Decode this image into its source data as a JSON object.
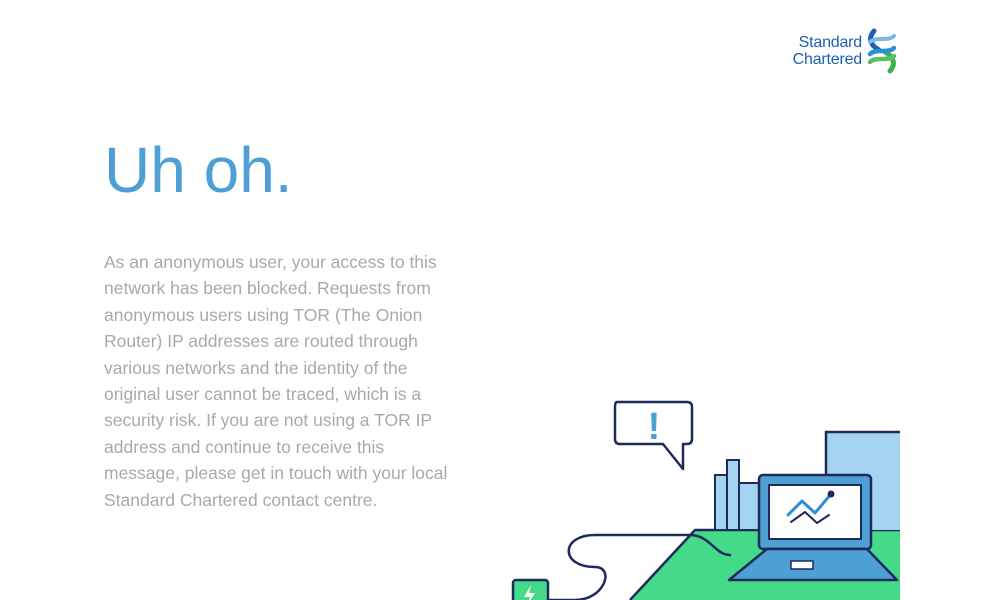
{
  "brand": {
    "line1": "Standard",
    "line2": "Chartered"
  },
  "headline": "Uh oh.",
  "message": "As an anonymous user, your access to this network has been blocked. Requests from anonymous users using TOR (The Onion Router) IP addresses are routed through various networks and the identity of the original user cannot be traced, which is a security risk. If you are not using a TOR IP address and continue to receive this message, please get in touch with your local Standard Chartered contact centre.",
  "illustration": {
    "alert_symbol": "!",
    "icons": [
      "speech-bubble-icon",
      "laptop-icon",
      "chart-line-icon",
      "charger-icon",
      "lightning-icon",
      "building-icon"
    ]
  },
  "colors": {
    "headline": "#4d9fd4",
    "body_text": "#a9a9a9",
    "brand_blue": "#1b5fb3",
    "brand_green": "#38b349",
    "outline": "#1d2b5b",
    "desk_green": "#45d98a",
    "building_blue": "#a4d4f2"
  }
}
